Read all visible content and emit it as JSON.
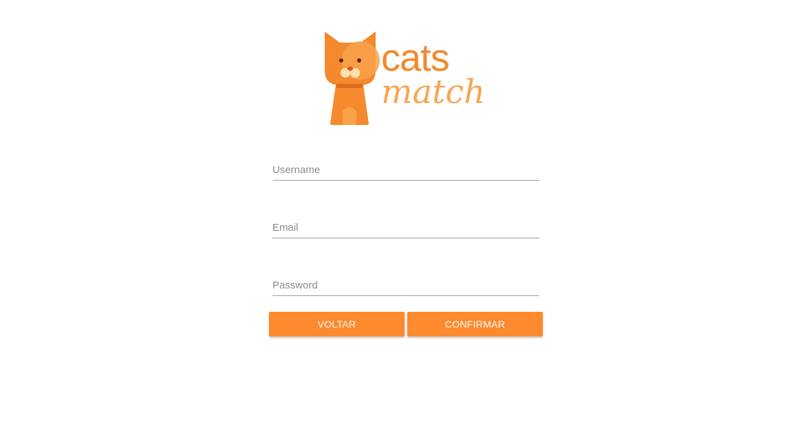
{
  "logo": {
    "word1": "cats",
    "word2": "match",
    "icon": "cat-icon"
  },
  "form": {
    "username_placeholder": "Username",
    "username_value": "",
    "email_placeholder": "Email",
    "email_value": "",
    "password_placeholder": "Password",
    "password_value": ""
  },
  "buttons": {
    "back_label": "VOLTAR",
    "confirm_label": "CONFIRMAR"
  },
  "colors": {
    "primary": "#fd8a2e",
    "logo_orange": "#f4892e",
    "underline": "#9e9e9e"
  }
}
